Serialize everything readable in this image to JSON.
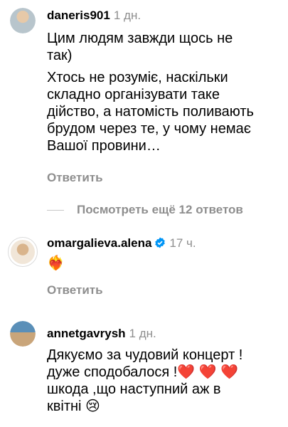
{
  "comments": [
    {
      "username": "daneris901",
      "time": "1 дн.",
      "text1": "Цим людям завжди щось не\nтак)",
      "text2": "Хтось не розуміє, наскільки\nскладно організувати таке\nдійство, а натомість поливають\nбрудом через те, у чому немає\nВашої провини…",
      "reply_label": "Ответить"
    },
    {
      "username": "omargalieva.alena",
      "time": "17 ч.",
      "text": "❤️‍🔥",
      "reply_label": "Ответить"
    },
    {
      "username": "annetgavrysh",
      "time": "1 дн.",
      "text": "Дякуємо за чудовий концерт !\nдуже сподобалося !❤️ ❤️ ❤️\nшкода ,що наступний аж в\nквітні 😢"
    }
  ],
  "view_replies_label": "Посмотреть ещё 12 ответов",
  "colors": {
    "secondary_text": "#8e8e8e",
    "verified_blue": "#0095f6",
    "heart_red": "#e0242c"
  }
}
